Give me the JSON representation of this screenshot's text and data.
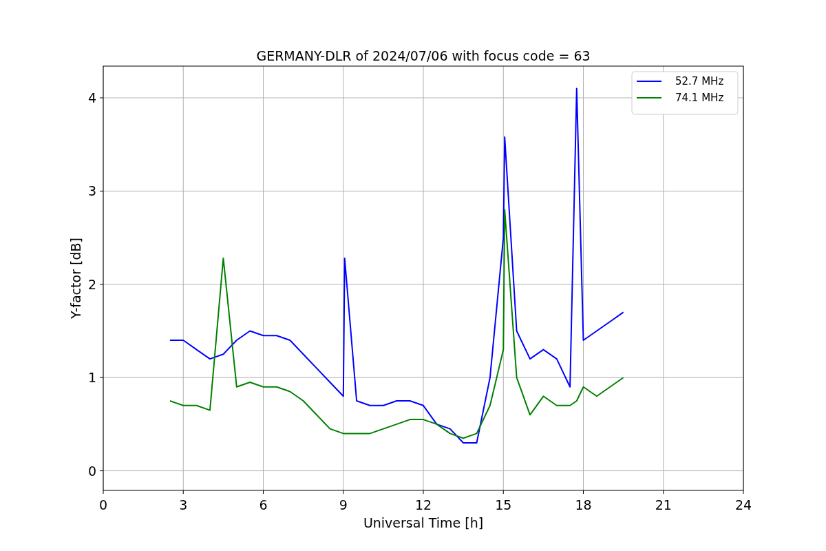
{
  "chart_data": {
    "type": "line",
    "title": "GERMANY-DLR of 2024/07/06 with focus code = 63",
    "xlabel": "Universal Time [h]",
    "ylabel": "Y-factor [dB]",
    "x": [
      2.5,
      3,
      3.5,
      4,
      4.5,
      5,
      5.5,
      6,
      6.5,
      7,
      7.5,
      8,
      8.5,
      9,
      9.05,
      9.5,
      10,
      10.5,
      11,
      11.5,
      12,
      12.5,
      13,
      13.5,
      14,
      14.5,
      15,
      15.05,
      15.5,
      16,
      16.5,
      17,
      17.5,
      17.75,
      18,
      18.5,
      19,
      19.5
    ],
    "series": [
      {
        "name": "52.7 MHz",
        "color": "#0000ff",
        "values": [
          1.4,
          1.4,
          1.3,
          1.2,
          1.25,
          1.4,
          1.5,
          1.45,
          1.45,
          1.4,
          1.25,
          1.1,
          0.95,
          0.8,
          2.28,
          0.75,
          0.7,
          0.7,
          0.75,
          0.75,
          0.7,
          0.5,
          0.45,
          0.3,
          0.3,
          1.0,
          2.5,
          3.58,
          1.5,
          1.2,
          1.3,
          1.2,
          0.9,
          4.1,
          1.4,
          1.5,
          1.6,
          1.7
        ]
      },
      {
        "name": "74.1 MHz",
        "color": "#008000",
        "values": [
          0.75,
          0.7,
          0.7,
          0.65,
          2.28,
          0.9,
          0.95,
          0.9,
          0.9,
          0.85,
          0.75,
          0.6,
          0.45,
          0.4,
          0.4,
          0.4,
          0.4,
          0.45,
          0.5,
          0.55,
          0.55,
          0.5,
          0.4,
          0.35,
          0.4,
          0.7,
          1.3,
          2.8,
          1.0,
          0.6,
          0.8,
          0.7,
          0.7,
          0.75,
          0.9,
          0.8,
          0.9,
          1.0
        ]
      }
    ],
    "grid": true,
    "legend": true,
    "xlim": [
      0,
      24
    ],
    "ylim": [
      -0.21,
      4.34
    ],
    "xticks": [
      0,
      3,
      6,
      9,
      12,
      15,
      18,
      21,
      24
    ],
    "yticks": [
      0,
      1,
      2,
      3,
      4
    ]
  }
}
